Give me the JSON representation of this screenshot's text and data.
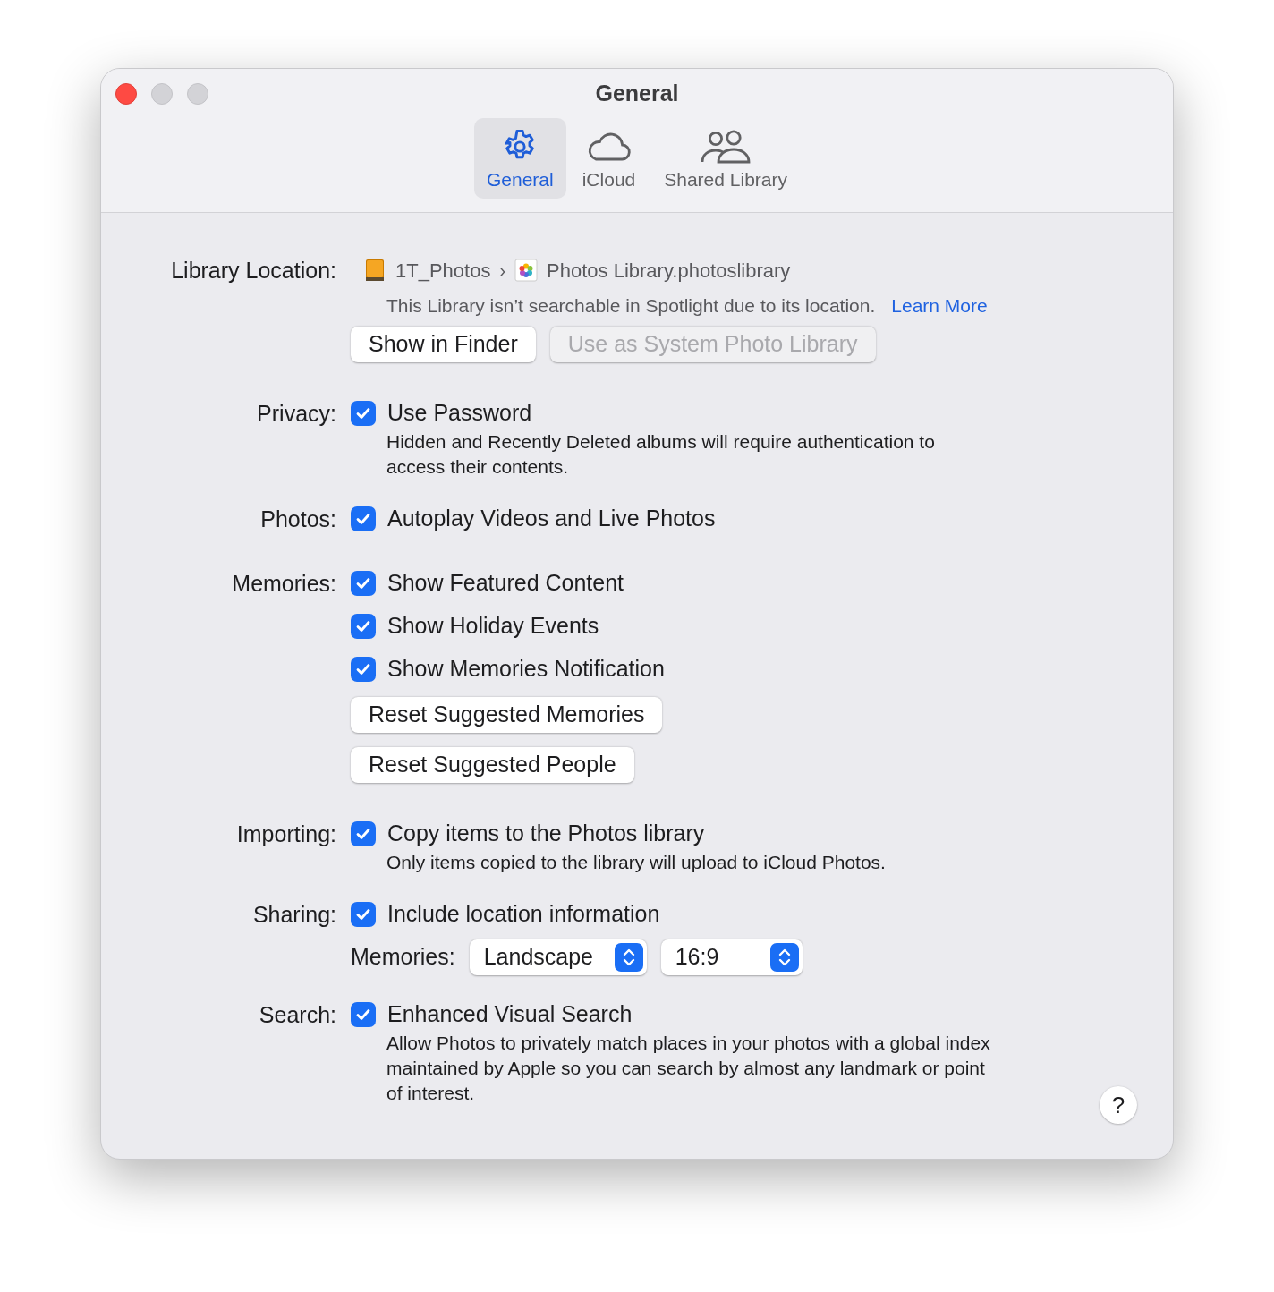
{
  "window": {
    "title": "General"
  },
  "tabs": [
    {
      "label": "General",
      "selected": true
    },
    {
      "label": "iCloud",
      "selected": false
    },
    {
      "label": "Shared Library",
      "selected": false
    }
  ],
  "sections": [
    {
      "label": "Library Location:",
      "items": [
        {
          "kind": "path",
          "segments": [
            "1T_Photos",
            "Photos Library.photoslibrary"
          ],
          "separator": "›"
        },
        {
          "kind": "note",
          "text": "This Library isn’t searchable in Spotlight due to its location.",
          "link": "Learn More"
        },
        {
          "kind": "buttons",
          "buttons": [
            {
              "label": "Show in Finder",
              "disabled": false
            },
            {
              "label": "Use as System Photo Library",
              "disabled": true
            }
          ]
        }
      ]
    },
    {
      "label": "Privacy:",
      "items": [
        {
          "kind": "checkbox",
          "label": "Use Password",
          "checked": true,
          "note": "Hidden and Recently Deleted albums will require authentication to access their contents."
        }
      ]
    },
    {
      "label": "Photos:",
      "items": [
        {
          "kind": "checkbox",
          "label": "Autoplay Videos and Live Photos",
          "checked": true
        }
      ]
    },
    {
      "label": "Memories:",
      "items": [
        {
          "kind": "checkbox",
          "label": "Show Featured Content",
          "checked": true
        },
        {
          "kind": "checkbox",
          "label": "Show Holiday Events",
          "checked": true
        },
        {
          "kind": "checkbox",
          "label": "Show Memories Notification",
          "checked": true
        },
        {
          "kind": "buttons",
          "buttons": [
            {
              "label": "Reset Suggested Memories",
              "disabled": false
            }
          ]
        },
        {
          "kind": "buttons",
          "buttons": [
            {
              "label": "Reset Suggested People",
              "disabled": false
            }
          ]
        }
      ]
    },
    {
      "label": "Importing:",
      "items": [
        {
          "kind": "checkbox",
          "label": "Copy items to the Photos library",
          "checked": true,
          "note": "Only items copied to the library will upload to iCloud Photos."
        }
      ]
    },
    {
      "label": "Sharing:",
      "items": [
        {
          "kind": "checkbox",
          "label": "Include location information",
          "checked": true
        },
        {
          "kind": "popups",
          "label": "Memories:",
          "popups": [
            {
              "value": "Landscape"
            },
            {
              "value": "16:9"
            }
          ]
        }
      ]
    },
    {
      "label": "Search:",
      "items": [
        {
          "kind": "checkbox",
          "label": "Enhanced Visual Search",
          "checked": true,
          "note": "Allow Photos to privately match places in your photos with a global index maintained by Apple so you can search by almost any landmark or point of interest."
        }
      ]
    }
  ],
  "help_button": {
    "label": "?"
  }
}
